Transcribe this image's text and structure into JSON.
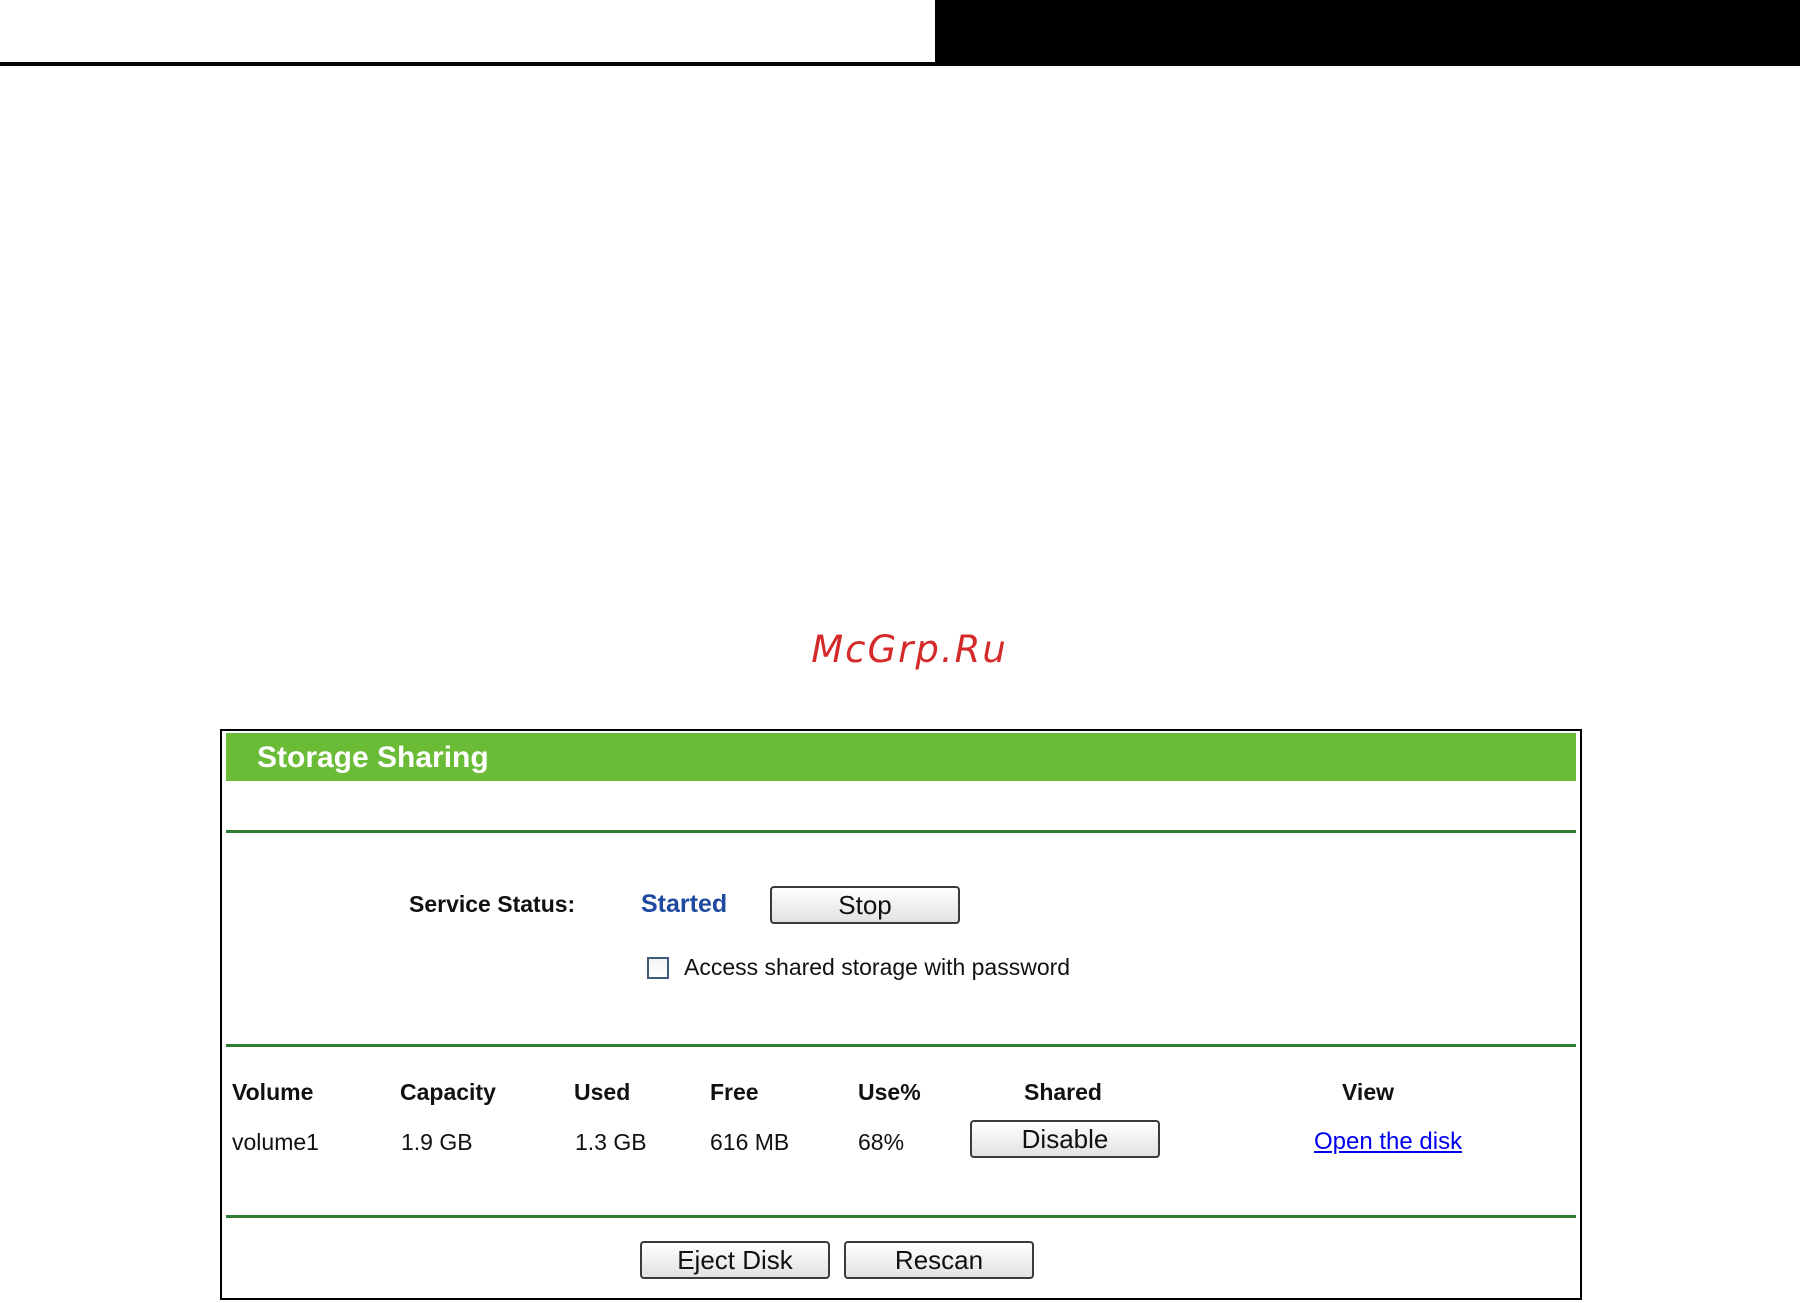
{
  "watermark": "McGrp.Ru",
  "panel": {
    "title": "Storage Sharing",
    "service_status_label": "Service Status:",
    "service_status_value": "Started",
    "stop_button": "Stop",
    "password_checkbox_label": "Access shared storage with password",
    "password_checkbox_checked": false,
    "table": {
      "headers": [
        "Volume",
        "Capacity",
        "Used",
        "Free",
        "Use%",
        "Shared",
        "View"
      ],
      "rows": [
        {
          "volume": "volume1",
          "capacity": "1.9 GB",
          "used": "1.3 GB",
          "free": "616 MB",
          "use_percent": "68%",
          "shared_button": "Disable",
          "view_link": "Open the disk"
        }
      ]
    },
    "eject_button": "Eject Disk",
    "rescan_button": "Rescan"
  },
  "colors": {
    "header_green": "#6abb36",
    "divider_green": "#2e7d32",
    "status_blue": "#1f4aa0",
    "link_blue": "#0000ee",
    "watermark_red": "#d42a2a"
  }
}
